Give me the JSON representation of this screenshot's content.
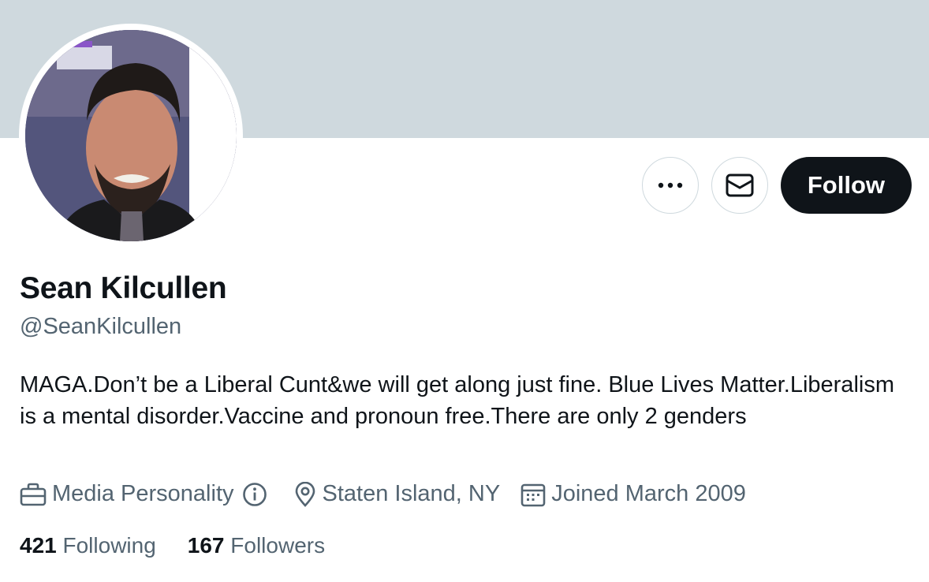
{
  "profile": {
    "name": "Sean Kilcullen",
    "handle": "@SeanKilcullen",
    "bio": "MAGA.Don’t be a Liberal Cunt&we will get along just fine. Blue Lives Matter.Liberalism is a mental disorder.Vaccine and pronoun free.There are only 2 genders",
    "category": "Media Personality",
    "location": "Staten Island, NY",
    "joined": "Joined March 2009"
  },
  "stats": {
    "following_count": "421",
    "following_label": "Following",
    "followers_count": "167",
    "followers_label": "Followers"
  },
  "actions": {
    "more_icon": "more-icon",
    "message_icon": "envelope-icon",
    "follow_label": "Follow"
  },
  "colors": {
    "banner": "#cfd9de",
    "text_primary": "#0f1419",
    "text_secondary": "#536471",
    "follow_button": "#0f1419",
    "border": "#cfd9de"
  }
}
